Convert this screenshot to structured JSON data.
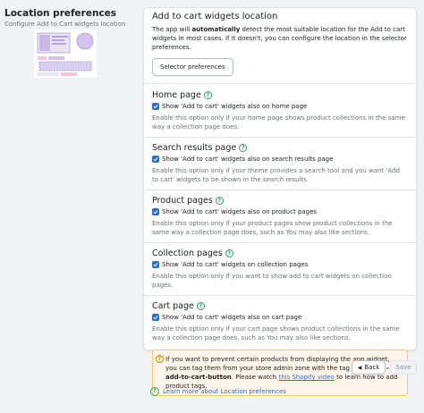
{
  "page": {
    "title": "Location preferences",
    "subtitle": "Configure Add to Cart widgets location"
  },
  "widget_location": {
    "title": "Add to cart widgets location",
    "description_before": "The app will ",
    "description_bold": "automatically",
    "description_after": " detect the most suitable location for the Add to cart widgets in most cases. If it doesn't, you can configure the location in the selector preferences.",
    "selector_button": "Selector preferences"
  },
  "sections": [
    {
      "title": "Home page",
      "checkbox": "Show 'Add to cart' widgets also on home page",
      "checked": true,
      "note": "Enable this option only if your home page shows product collections in the same way a collection page does."
    },
    {
      "title": "Search results page",
      "checkbox": "Show 'Add to cart' widgets also on search results page",
      "checked": true,
      "note": "Enable this option only if your theme provides a search tool and you want 'Add to cart' widgets to be shown in the search results."
    },
    {
      "title": "Product pages",
      "checkbox": "Show 'Add to cart' widgets also on product pages",
      "checked": true,
      "note": "Enable this option only if your product pages show product collections in the same way a collection page does, such as You may also like sections."
    },
    {
      "title": "Collection pages",
      "checkbox": "Show 'Add to cart' widgets on collection pages",
      "checked": true,
      "note": "Enable this option only if you want to show add to cart widgets on collection pages."
    },
    {
      "title": "Cart page",
      "checkbox": "Show 'Add to cart' widgets also on cart page",
      "checked": true,
      "note": "Enable this option only if your cart page shows product collections in the same way a collection page does, such as You may also like sections."
    }
  ],
  "banner": {
    "text1": "If you want to prevent certain products from displaying the app widget, you can tag them from your store admin zone with the tag ",
    "tag": "cbb-avoid-add-to-cart-button",
    "text2": ". Please watch ",
    "link": "this Shopify video",
    "text3": " to learn how to add product tags."
  },
  "actions": {
    "back": "Back",
    "save": "Save"
  },
  "learn_more": "Learn more about Location preferences",
  "colors": {
    "primary": "#2c6ecb",
    "help": "#2e9e62",
    "banner_bg": "#fff5ea",
    "banner_border": "#ffc96b"
  }
}
